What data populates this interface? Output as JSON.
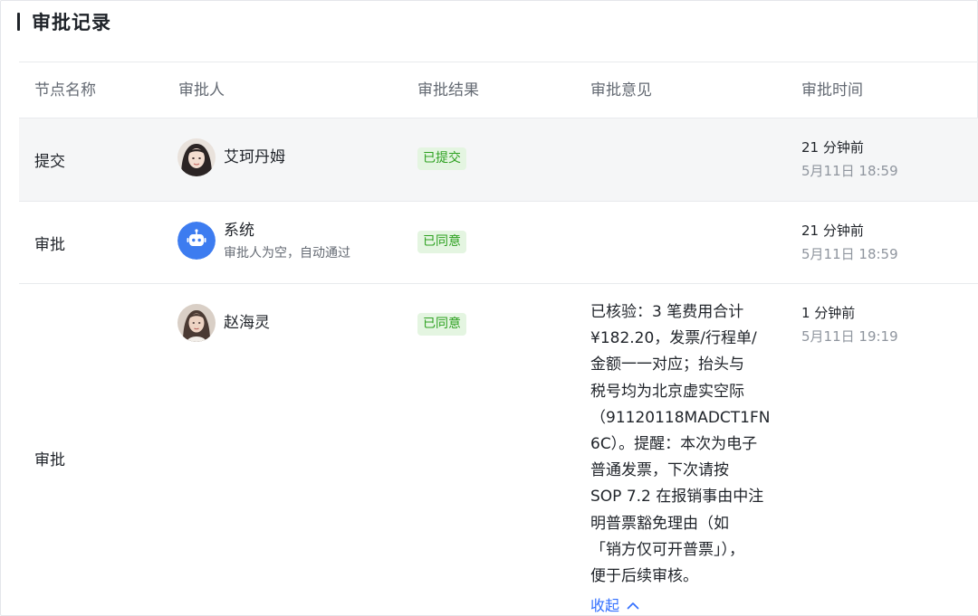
{
  "section": {
    "title": "审批记录"
  },
  "columns": {
    "node": "节点名称",
    "approver": "审批人",
    "result": "审批结果",
    "comment": "审批意见",
    "time": "审批时间"
  },
  "rows": [
    {
      "node": "提交",
      "approver": {
        "name": "艾珂丹姆",
        "sub": "",
        "avatar": "user-photo"
      },
      "result": "已提交",
      "comment": "",
      "time_relative": "21 分钟前",
      "time_absolute": "5月11日 18:59"
    },
    {
      "node": "审批",
      "approver": {
        "name": "系统",
        "sub": "审批人为空，自动通过",
        "avatar": "robot-icon"
      },
      "result": "已同意",
      "comment": "",
      "time_relative": "21 分钟前",
      "time_absolute": "5月11日 18:59"
    },
    {
      "node": "审批",
      "approver": {
        "name": "赵海灵",
        "sub": "",
        "avatar": "user-photo"
      },
      "result": "已同意",
      "comment": "已核验：3 笔费用合计\n¥182.20，发票/行程单/\n金额一一对应；抬头与\n税号均为北京虚实空际\n（91120118MADCT1FN\n6C）。提醒：本次为电子\n普通发票，下次请按\nSOP 7.2 在报销事由中注\n明普票豁免理由（如\n「销方仅可开普票」），\n便于后续审核。",
      "collapse_label": "收起",
      "time_relative": "1 分钟前",
      "time_absolute": "5月11日 19:19"
    }
  ],
  "colors": {
    "tag_green_text": "#2ea121",
    "tag_green_bg": "#e4f5e1",
    "link_blue": "#3370ff",
    "robot_blue": "#3d7cf0"
  }
}
